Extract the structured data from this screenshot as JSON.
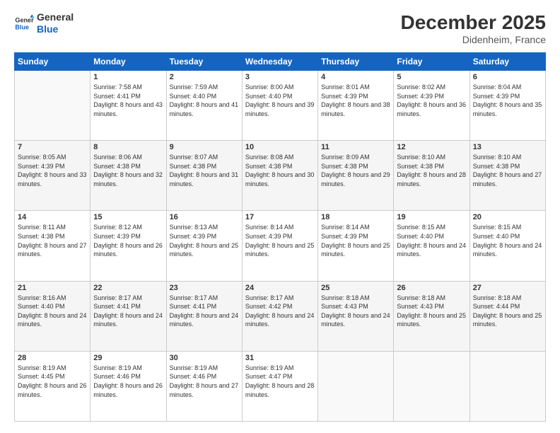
{
  "logo": {
    "line1": "General",
    "line2": "Blue"
  },
  "title": "December 2025",
  "location": "Didenheim, France",
  "days_of_week": [
    "Sunday",
    "Monday",
    "Tuesday",
    "Wednesday",
    "Thursday",
    "Friday",
    "Saturday"
  ],
  "weeks": [
    [
      {
        "day": "",
        "sunrise": "",
        "sunset": "",
        "daylight": ""
      },
      {
        "day": "1",
        "sunrise": "7:58 AM",
        "sunset": "4:41 PM",
        "daylight": "8 hours and 43 minutes."
      },
      {
        "day": "2",
        "sunrise": "7:59 AM",
        "sunset": "4:40 PM",
        "daylight": "8 hours and 41 minutes."
      },
      {
        "day": "3",
        "sunrise": "8:00 AM",
        "sunset": "4:40 PM",
        "daylight": "8 hours and 39 minutes."
      },
      {
        "day": "4",
        "sunrise": "8:01 AM",
        "sunset": "4:39 PM",
        "daylight": "8 hours and 38 minutes."
      },
      {
        "day": "5",
        "sunrise": "8:02 AM",
        "sunset": "4:39 PM",
        "daylight": "8 hours and 36 minutes."
      },
      {
        "day": "6",
        "sunrise": "8:04 AM",
        "sunset": "4:39 PM",
        "daylight": "8 hours and 35 minutes."
      }
    ],
    [
      {
        "day": "7",
        "sunrise": "8:05 AM",
        "sunset": "4:39 PM",
        "daylight": "8 hours and 33 minutes."
      },
      {
        "day": "8",
        "sunrise": "8:06 AM",
        "sunset": "4:38 PM",
        "daylight": "8 hours and 32 minutes."
      },
      {
        "day": "9",
        "sunrise": "8:07 AM",
        "sunset": "4:38 PM",
        "daylight": "8 hours and 31 minutes."
      },
      {
        "day": "10",
        "sunrise": "8:08 AM",
        "sunset": "4:38 PM",
        "daylight": "8 hours and 30 minutes."
      },
      {
        "day": "11",
        "sunrise": "8:09 AM",
        "sunset": "4:38 PM",
        "daylight": "8 hours and 29 minutes."
      },
      {
        "day": "12",
        "sunrise": "8:10 AM",
        "sunset": "4:38 PM",
        "daylight": "8 hours and 28 minutes."
      },
      {
        "day": "13",
        "sunrise": "8:10 AM",
        "sunset": "4:38 PM",
        "daylight": "8 hours and 27 minutes."
      }
    ],
    [
      {
        "day": "14",
        "sunrise": "8:11 AM",
        "sunset": "4:38 PM",
        "daylight": "8 hours and 27 minutes."
      },
      {
        "day": "15",
        "sunrise": "8:12 AM",
        "sunset": "4:39 PM",
        "daylight": "8 hours and 26 minutes."
      },
      {
        "day": "16",
        "sunrise": "8:13 AM",
        "sunset": "4:39 PM",
        "daylight": "8 hours and 25 minutes."
      },
      {
        "day": "17",
        "sunrise": "8:14 AM",
        "sunset": "4:39 PM",
        "daylight": "8 hours and 25 minutes."
      },
      {
        "day": "18",
        "sunrise": "8:14 AM",
        "sunset": "4:39 PM",
        "daylight": "8 hours and 25 minutes."
      },
      {
        "day": "19",
        "sunrise": "8:15 AM",
        "sunset": "4:40 PM",
        "daylight": "8 hours and 24 minutes."
      },
      {
        "day": "20",
        "sunrise": "8:15 AM",
        "sunset": "4:40 PM",
        "daylight": "8 hours and 24 minutes."
      }
    ],
    [
      {
        "day": "21",
        "sunrise": "8:16 AM",
        "sunset": "4:40 PM",
        "daylight": "8 hours and 24 minutes."
      },
      {
        "day": "22",
        "sunrise": "8:17 AM",
        "sunset": "4:41 PM",
        "daylight": "8 hours and 24 minutes."
      },
      {
        "day": "23",
        "sunrise": "8:17 AM",
        "sunset": "4:41 PM",
        "daylight": "8 hours and 24 minutes."
      },
      {
        "day": "24",
        "sunrise": "8:17 AM",
        "sunset": "4:42 PM",
        "daylight": "8 hours and 24 minutes."
      },
      {
        "day": "25",
        "sunrise": "8:18 AM",
        "sunset": "4:43 PM",
        "daylight": "8 hours and 24 minutes."
      },
      {
        "day": "26",
        "sunrise": "8:18 AM",
        "sunset": "4:43 PM",
        "daylight": "8 hours and 25 minutes."
      },
      {
        "day": "27",
        "sunrise": "8:18 AM",
        "sunset": "4:44 PM",
        "daylight": "8 hours and 25 minutes."
      }
    ],
    [
      {
        "day": "28",
        "sunrise": "8:19 AM",
        "sunset": "4:45 PM",
        "daylight": "8 hours and 26 minutes."
      },
      {
        "day": "29",
        "sunrise": "8:19 AM",
        "sunset": "4:46 PM",
        "daylight": "8 hours and 26 minutes."
      },
      {
        "day": "30",
        "sunrise": "8:19 AM",
        "sunset": "4:46 PM",
        "daylight": "8 hours and 27 minutes."
      },
      {
        "day": "31",
        "sunrise": "8:19 AM",
        "sunset": "4:47 PM",
        "daylight": "8 hours and 28 minutes."
      },
      {
        "day": "",
        "sunrise": "",
        "sunset": "",
        "daylight": ""
      },
      {
        "day": "",
        "sunrise": "",
        "sunset": "",
        "daylight": ""
      },
      {
        "day": "",
        "sunrise": "",
        "sunset": "",
        "daylight": ""
      }
    ]
  ],
  "labels": {
    "sunrise_prefix": "Sunrise: ",
    "sunset_prefix": "Sunset: ",
    "daylight_prefix": "Daylight: "
  }
}
